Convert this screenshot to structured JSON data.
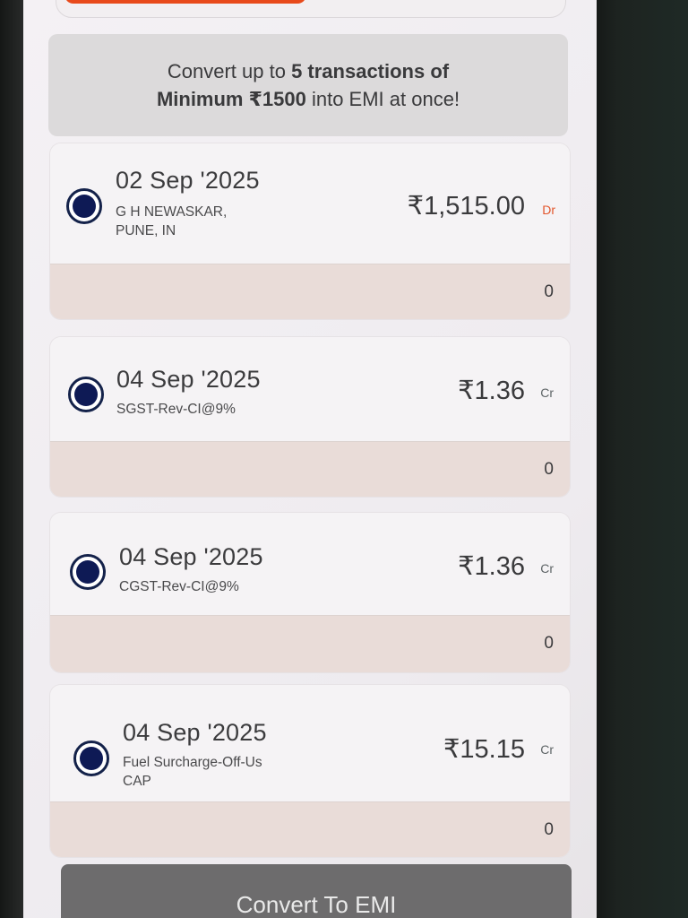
{
  "banner": {
    "line1_prefix": "Convert up to ",
    "line1_bold": "5 transactions of",
    "line2_bold": "Minimum ₹1500",
    "line2_suffix": " into EMI at once!"
  },
  "transactions": [
    {
      "date": "02 Sep '2025",
      "description": "G H NEWASKAR, PUNE, IN",
      "amount": "₹1,515.00",
      "type": "Dr",
      "count": "0",
      "selected": true
    },
    {
      "date": "04 Sep '2025",
      "description": "SGST-Rev-CI@9%",
      "amount": "₹1.36",
      "type": "Cr",
      "count": "0",
      "selected": true
    },
    {
      "date": "04 Sep '2025",
      "description": "CGST-Rev-CI@9%",
      "amount": "₹1.36",
      "type": "Cr",
      "count": "0",
      "selected": true
    },
    {
      "date": "04 Sep '2025",
      "description": "Fuel Surcharge-Off-Us CAP",
      "amount": "₹15.15",
      "type": "Cr",
      "count": "0",
      "selected": true
    }
  ],
  "convert_button": {
    "label": "Convert To EMI"
  },
  "colors": {
    "radio_fill": "#0e1a55",
    "debit_accent": "#e2552b",
    "top_button": "#e84a1b",
    "convert_button_bg": "#6d6c6d"
  },
  "icons": {
    "radio": "radio-selected-icon"
  }
}
